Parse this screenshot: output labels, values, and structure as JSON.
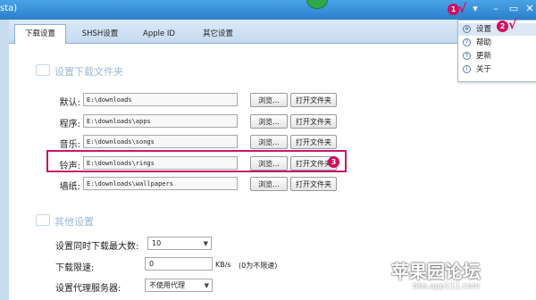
{
  "window": {
    "title_fragment": "sta)"
  },
  "tabs": [
    {
      "label": "下载设置",
      "active": true
    },
    {
      "label": "SHSH设置",
      "active": false
    },
    {
      "label": "Apple ID",
      "active": false
    },
    {
      "label": "其它设置",
      "active": false
    }
  ],
  "download_section": {
    "title": "设置下载文件夹",
    "rows": [
      {
        "label": "默认:",
        "path": "E:\\downloads",
        "browse": "浏览...",
        "open": "打开文件夹"
      },
      {
        "label": "程序:",
        "path": "E:\\downloads\\apps",
        "browse": "浏览...",
        "open": "打开文件夹"
      },
      {
        "label": "音乐:",
        "path": "E:\\downloads\\songs",
        "browse": "浏览...",
        "open": "打开文件夹"
      },
      {
        "label": "铃声:",
        "path": "E:\\downloads\\rings",
        "browse": "浏览...",
        "open": "打开文件夹"
      },
      {
        "label": "墙纸:",
        "path": "E:\\downloads\\wallpapers",
        "browse": "浏览...",
        "open": "打开文件夹"
      }
    ]
  },
  "other_section": {
    "title": "其他设置",
    "max_downloads_label": "设置同时下载最大数:",
    "max_downloads_value": "10",
    "speed_limit_label": "下载限速:",
    "speed_limit_value": "0",
    "speed_unit": "KB/s",
    "speed_hint": "(0为不限速)",
    "proxy_label": "设置代理服务器:",
    "proxy_value": "不使用代理"
  },
  "menu": {
    "items": [
      {
        "label": "设置",
        "icon": "gear-icon"
      },
      {
        "label": "帮助",
        "icon": "help-icon"
      },
      {
        "label": "更新",
        "icon": "update-icon"
      },
      {
        "label": "关于",
        "icon": "info-icon"
      }
    ]
  },
  "annotations": {
    "m1": "1",
    "m2": "2",
    "m3": "3",
    "check": "√"
  },
  "watermark": {
    "main": "苹果园论坛",
    "sub": "bbs.app111.com"
  },
  "colors": {
    "titlebar": "#2a7fcc",
    "highlight": "#c2186b",
    "marker": "#d0105f"
  }
}
